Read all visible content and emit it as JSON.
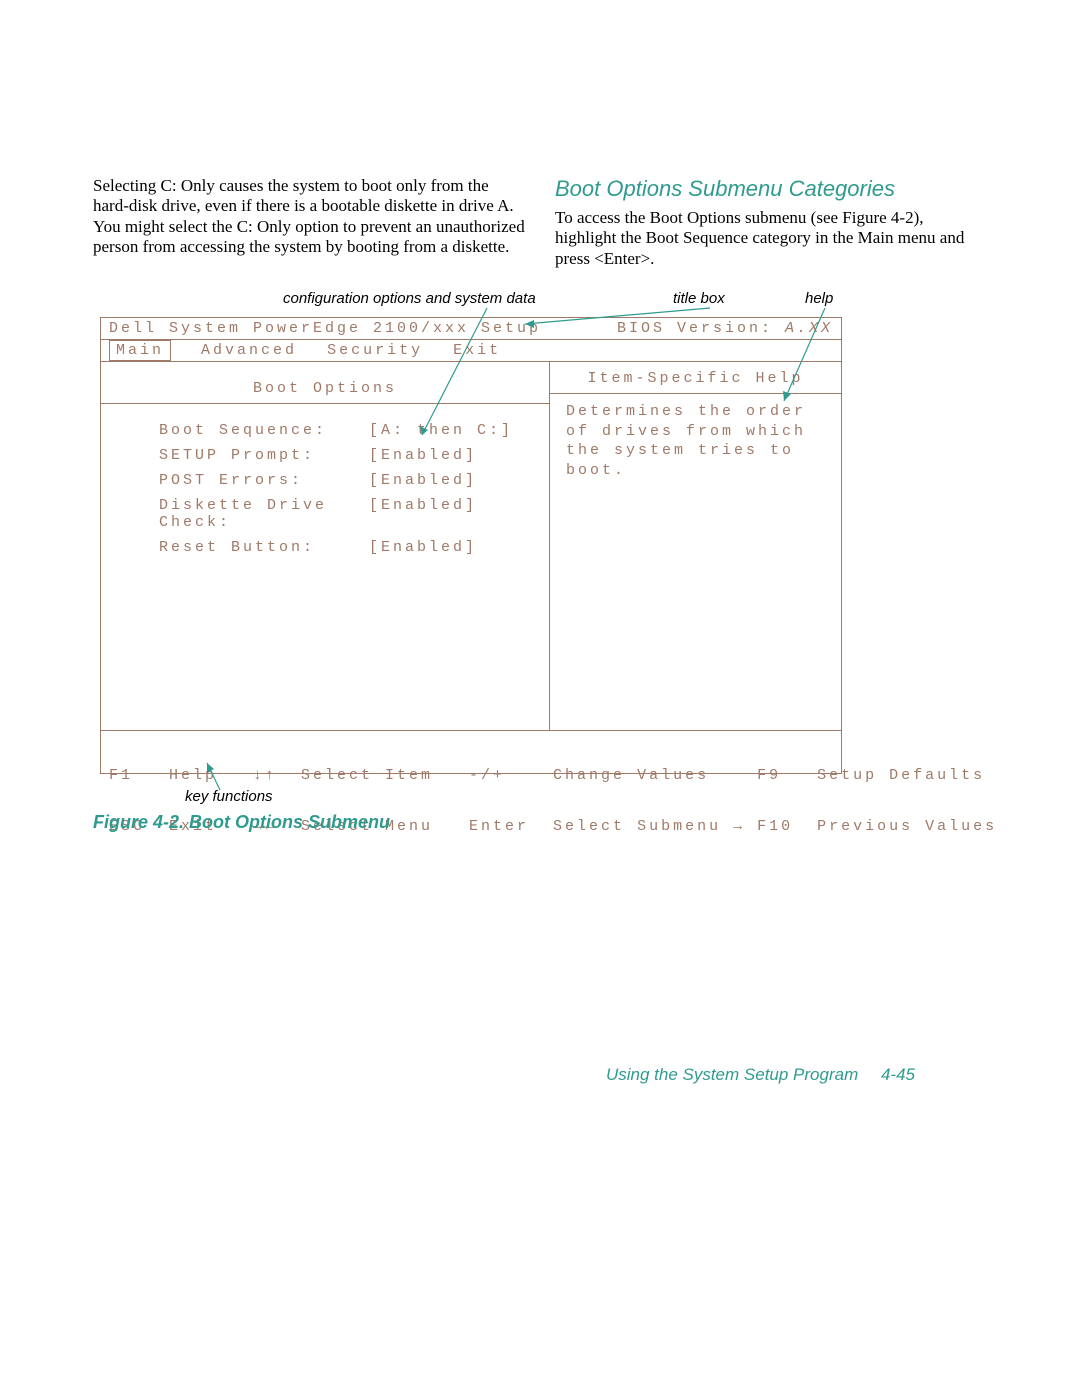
{
  "left_paragraph": "Selecting C: Only causes the system to boot only from the hard-disk drive, even if there is a bootable diskette in drive A. You might select the C: Only option to prevent an unauthorized person from accessing the system by booting from a diskette.",
  "right_heading": "Boot Options Submenu Categories",
  "right_paragraph": "To access the Boot Options submenu (see Figure 4-2), highlight the Boot Sequence category in the Main menu and press <Enter>.",
  "annot_config": "configuration options and system data",
  "annot_title": "title box",
  "annot_help": "help",
  "annot_keyfn": "key functions",
  "bios": {
    "system_title": "Dell System PowerEdge 2100/xxx Setup",
    "bios_version_label": "BIOS Version:",
    "bios_version_value": "A.XX",
    "menu": [
      "Main",
      "Advanced",
      "Security",
      "Exit"
    ],
    "submenu_title": "Boot Options",
    "options": [
      {
        "label": "Boot Sequence:",
        "value": "[A: then C:]"
      },
      {
        "label": "SETUP Prompt:",
        "value": "[Enabled]"
      },
      {
        "label": "POST Errors:",
        "value": "[Enabled]"
      },
      {
        "label": "Diskette Drive Check:",
        "value": "[Enabled]"
      },
      {
        "label": "Reset Button:",
        "value": "[Enabled]"
      }
    ],
    "help_title": "Item-Specific Help",
    "help_text": "Determines the order of drives from which the system tries to boot.",
    "keys_line1": "F1   Help   ↓↑  Select Item   -/+    Change Values    F9   Setup Defaults",
    "keys_line2": "ESC  Exit   →←  Select Menu   Enter  Select Submenu → F10  Previous Values"
  },
  "figure_caption": "Figure 4-2.  Boot Options Submenu",
  "footer_text": "Using the System Setup Program",
  "footer_page": "4-45"
}
